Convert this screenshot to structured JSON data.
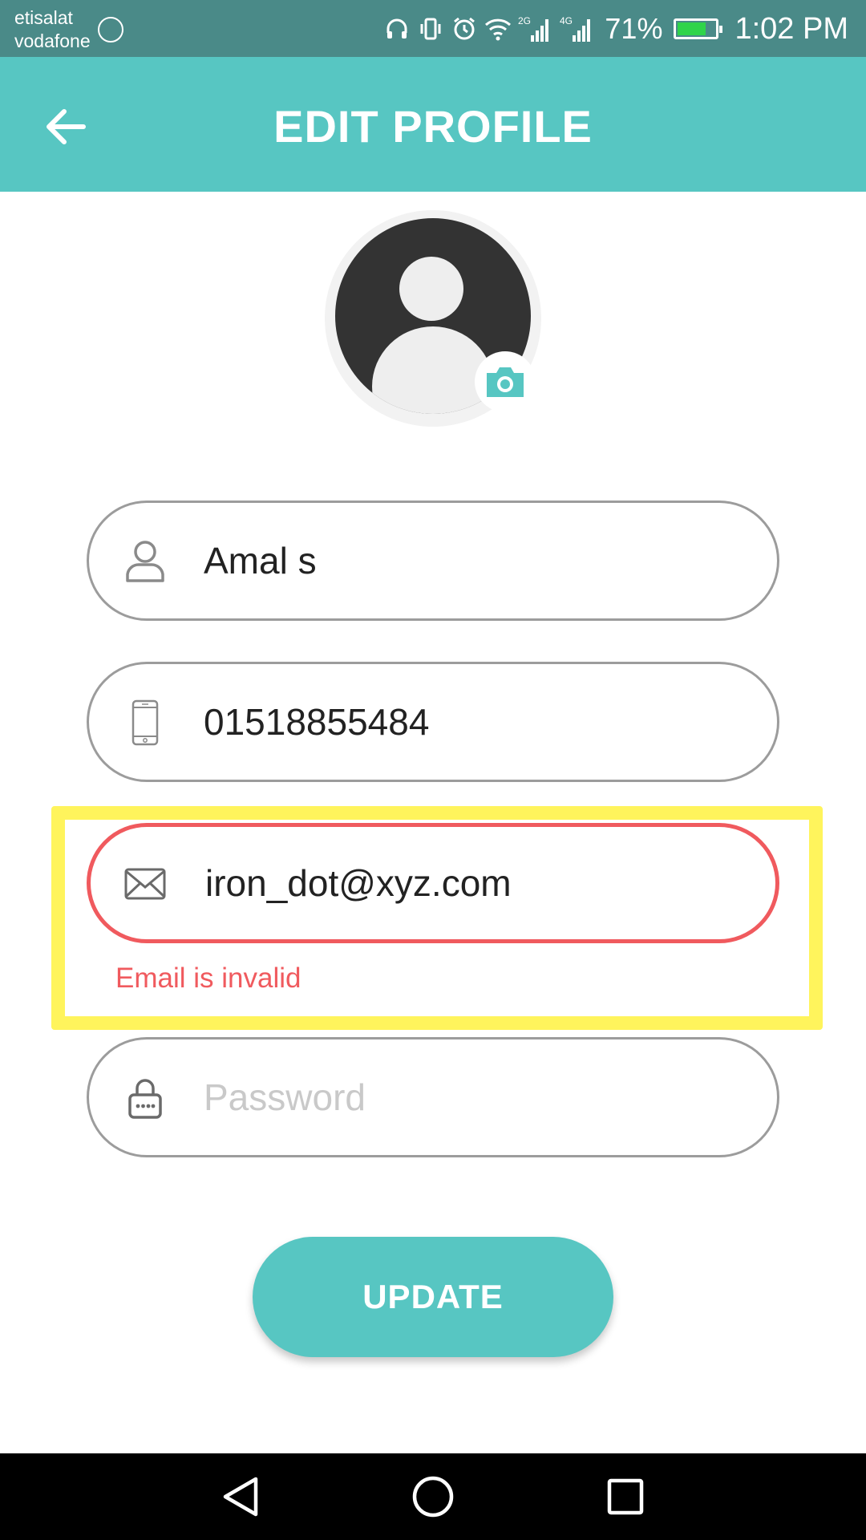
{
  "status_bar": {
    "carrier_1": "etisalat",
    "carrier_2": "vodafone",
    "network_1": "2G",
    "network_2": "4G",
    "battery": "71%",
    "time": "1:02 PM"
  },
  "header": {
    "title": "EDIT PROFILE"
  },
  "form": {
    "name_value": "Amal s",
    "phone_value": "01518855484",
    "email_value": "iron_dot@xyz.com",
    "email_error": "Email is invalid",
    "password_placeholder": "Password"
  },
  "actions": {
    "update_label": "UPDATE"
  },
  "colors": {
    "accent": "#57c6c2",
    "error": "#f05a5e",
    "highlight": "#fff45c",
    "status_bar": "#4a8a88"
  },
  "icons": {
    "back": "arrow-left-icon",
    "avatar": "user-avatar-icon",
    "camera": "camera-icon",
    "name": "person-icon",
    "phone": "phone-icon",
    "email": "envelope-icon",
    "password": "lock-icon"
  }
}
